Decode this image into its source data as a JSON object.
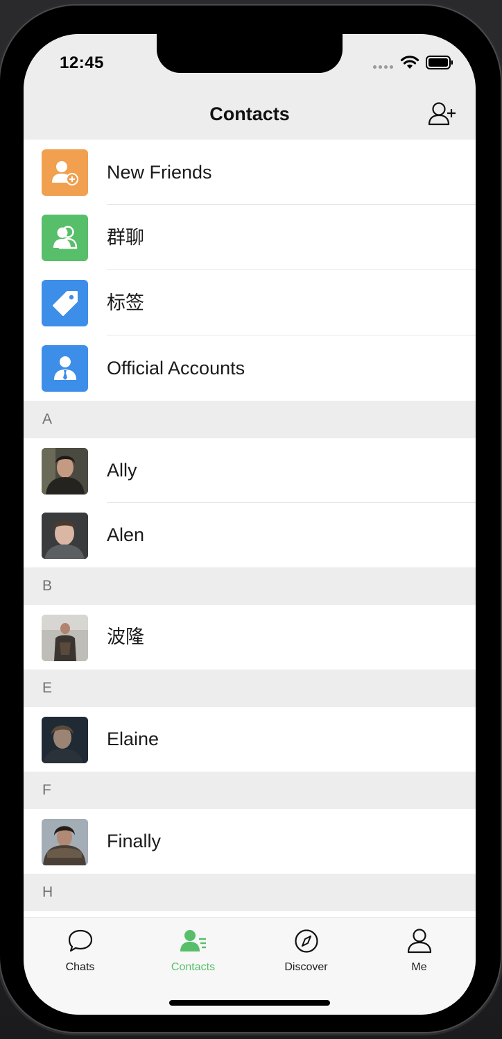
{
  "status_bar": {
    "time": "12:45"
  },
  "nav": {
    "title": "Contacts",
    "add_icon": "add-contact-icon"
  },
  "function_rows": [
    {
      "label": "New Friends",
      "icon": "new-friends-icon",
      "color": "#f0a04f"
    },
    {
      "label": "群聊",
      "icon": "group-chat-icon",
      "color": "#57be6a"
    },
    {
      "label": "标签",
      "icon": "tag-icon",
      "color": "#3d8ee8"
    },
    {
      "label": "Official Accounts",
      "icon": "official-accounts-icon",
      "color": "#3d8ee8"
    }
  ],
  "sections": [
    {
      "letter": "A",
      "contacts": [
        "Ally",
        "Alen"
      ]
    },
    {
      "letter": "B",
      "contacts": [
        "波隆"
      ]
    },
    {
      "letter": "E",
      "contacts": [
        "Elaine"
      ]
    },
    {
      "letter": "F",
      "contacts": [
        "Finally"
      ]
    },
    {
      "letter": "H",
      "contacts": []
    }
  ],
  "tabs": [
    {
      "label": "Chats",
      "icon": "chat-bubble-icon",
      "active": false
    },
    {
      "label": "Contacts",
      "icon": "contacts-icon",
      "active": true
    },
    {
      "label": "Discover",
      "icon": "compass-icon",
      "active": false
    },
    {
      "label": "Me",
      "icon": "person-icon",
      "active": false
    }
  ],
  "colors": {
    "accent": "#57be6a",
    "header_bg": "#ededed"
  }
}
